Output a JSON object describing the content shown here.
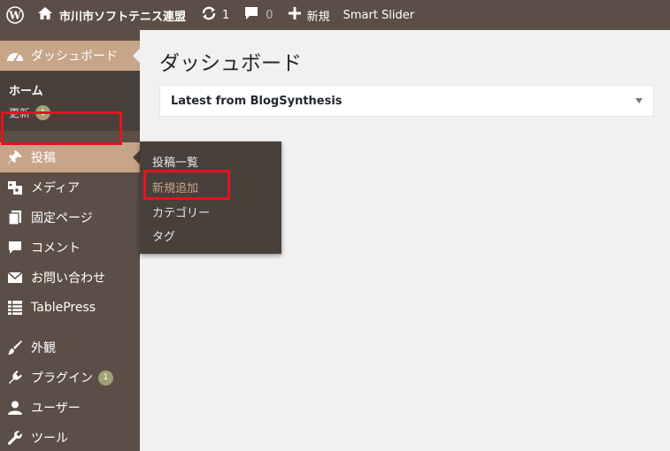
{
  "adminbar": {
    "site_name": "市川市ソフトテニス連盟",
    "updates_count": "1",
    "comments_count": "0",
    "new_label": "新規",
    "smart_slider_label": "Smart Slider"
  },
  "sidebar": {
    "dashboard_label": "ダッシュボード",
    "home_label": "ホーム",
    "updates_label": "更新",
    "updates_badge": "1",
    "items": [
      {
        "label": "投稿",
        "icon": "pin-icon"
      },
      {
        "label": "メディア",
        "icon": "media-icon"
      },
      {
        "label": "固定ページ",
        "icon": "pages-icon"
      },
      {
        "label": "コメント",
        "icon": "comment-icon"
      },
      {
        "label": "お問い合わせ",
        "icon": "mail-icon"
      },
      {
        "label": "TablePress",
        "icon": "table-icon"
      },
      {
        "label": "外観",
        "icon": "brush-icon"
      },
      {
        "label": "プラグイン",
        "icon": "plugin-icon",
        "badge": "1"
      },
      {
        "label": "ユーザー",
        "icon": "user-icon"
      },
      {
        "label": "ツール",
        "icon": "wrench-icon"
      }
    ]
  },
  "flyout": {
    "items": [
      "投稿一覧",
      "新規追加",
      "カテゴリー",
      "タグ"
    ]
  },
  "main": {
    "title": "ダッシュボード",
    "widget_title": "Latest from BlogSynthesis"
  },
  "colors": {
    "sidebar_bg": "#5b4e47",
    "accent": "#c7a589",
    "highlight_box": "#e5141e"
  }
}
